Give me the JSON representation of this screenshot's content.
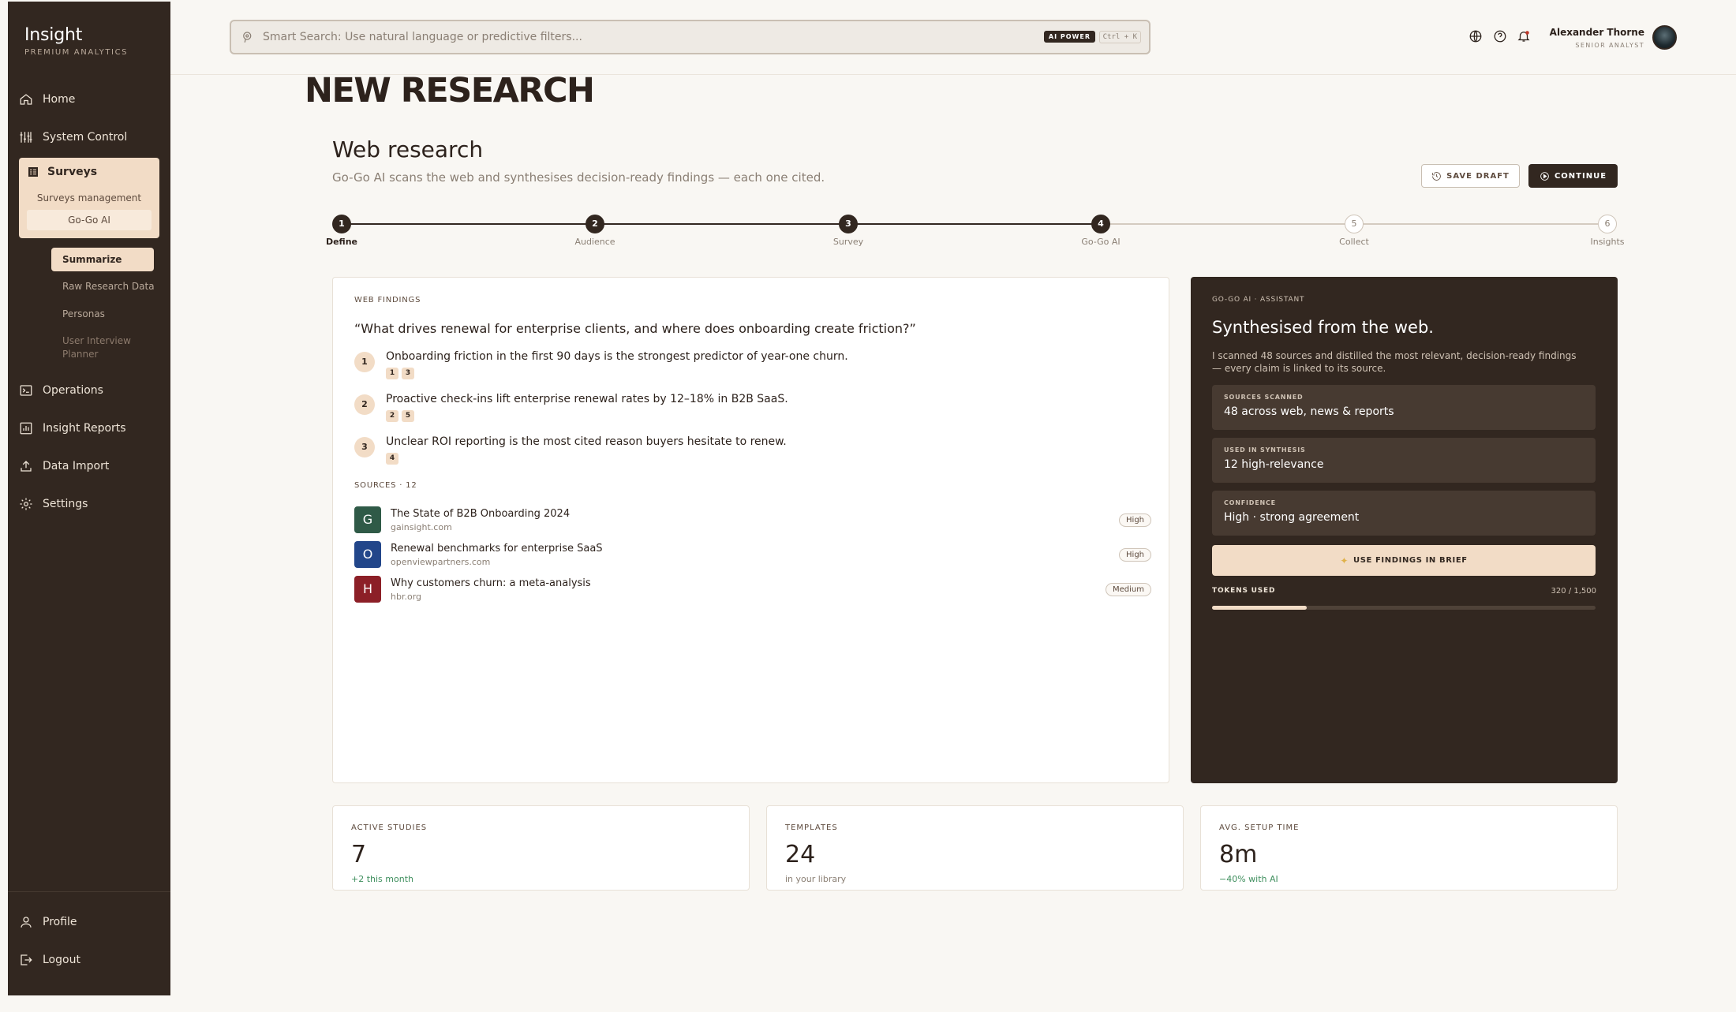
{
  "brand": {
    "title": "Insight",
    "subtitle": "PREMIUM ANALYTICS"
  },
  "sidebar": {
    "home": "Home",
    "system_control": "System Control",
    "surveys": "Surveys",
    "surveys_management": "Surveys management",
    "gogo_ai": "Go-Go AI",
    "summarize": "Summarize",
    "raw_research": "Raw Research Data",
    "personas": "Personas",
    "user_interview_planner": "User Interview Planner",
    "operations": "Operations",
    "insight_reports": "Insight Reports",
    "data_import": "Data Import",
    "settings": "Settings",
    "profile": "Profile",
    "logout": "Logout"
  },
  "search": {
    "placeholder": "Smart Search: Use natural language or predictive filters...",
    "badge": "AI POWER",
    "shortcut": "Ctrl + K"
  },
  "user": {
    "name": "Alexander Thorne",
    "role": "SENIOR ANALYST"
  },
  "page": {
    "title": "NEW RESEARCH",
    "section_title": "Web research",
    "section_subtitle": "Go-Go AI scans the web and synthesises decision-ready findings — each one cited.",
    "save_draft": "SAVE DRAFT",
    "continue": "CONTINUE"
  },
  "steps": [
    {
      "num": "1",
      "label": "Define",
      "state": "done"
    },
    {
      "num": "2",
      "label": "Audience",
      "state": "done"
    },
    {
      "num": "3",
      "label": "Survey",
      "state": "done"
    },
    {
      "num": "4",
      "label": "Go-Go AI",
      "state": "done"
    },
    {
      "num": "5",
      "label": "Collect",
      "state": "todo"
    },
    {
      "num": "6",
      "label": "Insights",
      "state": "todo"
    }
  ],
  "findings": {
    "eyebrow": "WEB FINDINGS",
    "question": "“What drives renewal for enterprise clients, and where does onboarding create friction?”",
    "items": [
      {
        "num": "1",
        "text": "Onboarding friction in the first 90 days is the strongest predictor of year-one churn.",
        "cites": [
          "1",
          "3"
        ]
      },
      {
        "num": "2",
        "text": "Proactive check-ins lift enterprise renewal rates by 12–18% in B2B SaaS.",
        "cites": [
          "2",
          "5"
        ]
      },
      {
        "num": "3",
        "text": "Unclear ROI reporting is the most cited reason buyers hesitate to renew.",
        "cites": [
          "4"
        ]
      }
    ],
    "sources_label": "SOURCES · 12",
    "sources": [
      {
        "letter": "G",
        "title": "The State of B2B Onboarding 2024",
        "domain": "gainsight.com",
        "badge": "High",
        "color": "#2f5a47"
      },
      {
        "letter": "O",
        "title": "Renewal benchmarks for enterprise SaaS",
        "domain": "openviewpartners.com",
        "badge": "High",
        "color": "#22468a"
      },
      {
        "letter": "H",
        "title": "Why customers churn: a meta-analysis",
        "domain": "hbr.org",
        "badge": "Medium",
        "color": "#8c1f27"
      }
    ]
  },
  "assistant": {
    "eyebrow": "GO-GO AI · ASSISTANT",
    "title": "Synthesised from the web.",
    "description": "I scanned 48 sources and distilled the most relevant, decision-ready findings — every claim is linked to its source.",
    "stats": [
      {
        "label": "SOURCES SCANNED",
        "value": "48 across web, news & reports"
      },
      {
        "label": "USED IN SYNTHESIS",
        "value": "12 high-relevance"
      },
      {
        "label": "CONFIDENCE",
        "value": "High · strong agreement"
      }
    ],
    "use_button": "USE FINDINGS IN BRIEF",
    "tokens_label": "TOKENS USED",
    "tokens_count": "320 / 1,500",
    "tokens_fraction": 0.2467
  },
  "metrics": [
    {
      "label": "ACTIVE STUDIES",
      "value": "7",
      "note": "+2 this month",
      "positive": true
    },
    {
      "label": "TEMPLATES",
      "value": "24",
      "note": "in your library",
      "positive": false
    },
    {
      "label": "AVG. SETUP TIME",
      "value": "8m",
      "note": "−40% with AI",
      "positive": true
    }
  ]
}
